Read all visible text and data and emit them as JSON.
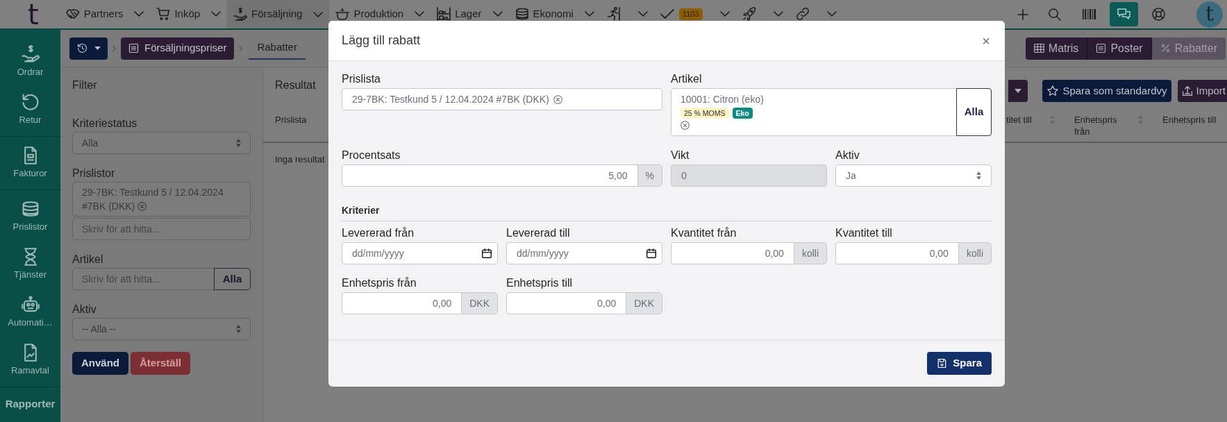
{
  "top_nav": {
    "logo": "t",
    "menus": [
      {
        "label": "Partners",
        "selected": false
      },
      {
        "label": "Inköp",
        "selected": false
      },
      {
        "label": "Försäljning",
        "selected": true
      },
      {
        "label": "Produktion",
        "selected": false
      },
      {
        "label": "Lager",
        "selected": false
      },
      {
        "label": "Ekonomi",
        "selected": false
      },
      {
        "selected": false
      },
      {
        "badge": "1103",
        "selected": false
      },
      {
        "selected": false
      },
      {
        "selected": false
      }
    ],
    "avatar": "t"
  },
  "sidebar": {
    "groups": [
      {
        "items": [
          {
            "label": "Ordrar"
          },
          {
            "label": "Retur"
          }
        ]
      },
      {
        "items": [
          {
            "label": "Fakturor"
          }
        ]
      },
      {
        "items": [
          {
            "label": "Prislistor"
          },
          {
            "label": "Tjänster"
          },
          {
            "label": "Automati…"
          },
          {
            "label": "Ramavtal"
          }
        ]
      }
    ],
    "footer": "Rapporter"
  },
  "breadcrumb": [
    {
      "label": "Försäljningspriser",
      "selected": false
    },
    {
      "label": "Rabatter",
      "selected": true
    }
  ],
  "view_switch": [
    {
      "label": "Matris",
      "selected": false
    },
    {
      "label": "Poster",
      "selected": false
    },
    {
      "label": "Rabatter",
      "selected": true
    }
  ],
  "filter": {
    "title": "Filter",
    "fields": [
      {
        "kind": "select",
        "label": "Kriteriestatus",
        "value": "Alla"
      },
      {
        "kind": "tags",
        "label": "Prislistor",
        "tags": [
          "29-7BK: Testkund 5 / 12.04.2024 #7BK (DKK)"
        ],
        "placeholder": "Skriv för att hitta..."
      },
      {
        "kind": "search",
        "label": "Artikel",
        "placeholder": "Skriv för att hitta...",
        "button": "Alla"
      },
      {
        "kind": "select",
        "label": "Aktiv",
        "value": "-- Alla --"
      }
    ],
    "buttons": [
      {
        "label": "Använd",
        "kind": "primary"
      },
      {
        "label": "Återställ",
        "kind": "danger"
      }
    ]
  },
  "results": {
    "title": "Resultat",
    "toolbar": [
      {
        "label": "Spara som standardvy",
        "kind": "primary"
      },
      {
        "label": "Import",
        "kind": "secondary"
      }
    ],
    "columns": [
      {
        "label": "Prislista"
      },
      {
        "label": "titet till"
      },
      {
        "label": "Enhetspris från"
      },
      {
        "label": "Enhetspris till"
      }
    ],
    "empty_text": "Inga resultat"
  },
  "modal": {
    "title": "Lägg till rabatt",
    "close": "×",
    "fields": [
      {
        "kind": "tags",
        "label": "Prislista",
        "tags": [
          "29-7BK: Testkund 5 / 12.04.2024 #7BK (DKK)"
        ],
        "disabled": false
      },
      {
        "kind": "article",
        "label": "Artikel",
        "value": "10001: Citron (eko)",
        "badges": [
          {
            "text": "25 % MOMS",
            "color": "#fcf6c6"
          },
          {
            "text": "Eko",
            "color": "#0e8a84"
          }
        ],
        "button": "Alla",
        "disabled": false
      },
      {
        "kind": "number",
        "label": "Procentsats",
        "value": "5,00",
        "unit": "%",
        "disabled": false
      },
      {
        "kind": "number",
        "label": "Vikt",
        "value": "0",
        "disabled": true
      },
      {
        "kind": "select",
        "label": "Aktiv",
        "value": "Ja",
        "disabled": false
      }
    ],
    "criteria_title": "Kriterier",
    "criteria": [
      {
        "kind": "date",
        "label": "Levererad från",
        "placeholder": "dd/mm/yyyy",
        "disabled": false
      },
      {
        "kind": "date",
        "label": "Levererad till",
        "placeholder": "dd/mm/yyyy",
        "disabled": false
      },
      {
        "kind": "number",
        "label": "Kvantitet från",
        "value": "0,00",
        "unit": "kolli",
        "disabled": false
      },
      {
        "kind": "number",
        "label": "Kvantitet till",
        "value": "0,00",
        "unit": "kolli",
        "disabled": false
      },
      {
        "kind": "number",
        "label": "Enhetspris från",
        "value": "0,00",
        "unit": "DKK",
        "disabled": false
      },
      {
        "kind": "number",
        "label": "Enhetspris till",
        "value": "0,00",
        "unit": "DKK",
        "disabled": false
      }
    ],
    "save": "Spara"
  }
}
